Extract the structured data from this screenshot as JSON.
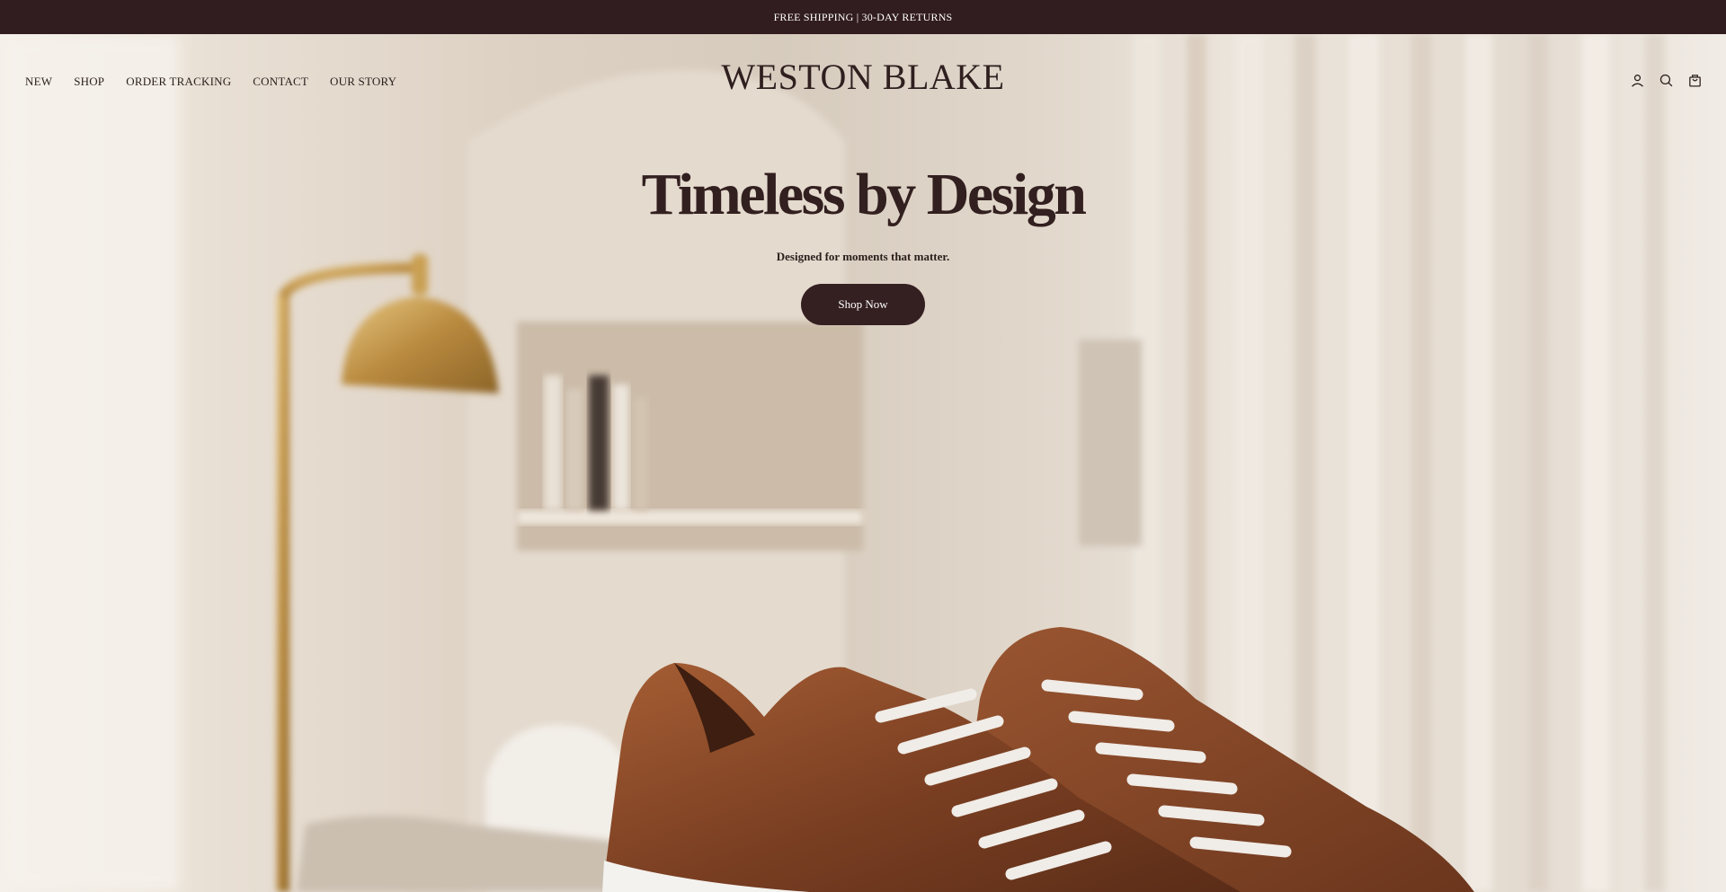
{
  "announcement": {
    "text": "FREE SHIPPING | 30-DAY RETURNS"
  },
  "header": {
    "logo": "WESTON BLAKE",
    "nav": [
      "NEW",
      "SHOP",
      "ORDER TRACKING",
      "CONTACT",
      "OUR STORY"
    ],
    "icons": [
      "account-icon",
      "search-icon",
      "cart-icon"
    ]
  },
  "hero": {
    "title": "Timeless by Design",
    "subtitle": "Designed for moments that matter.",
    "cta_label": "Shop Now",
    "image_description_icon": "sneaker-photo"
  },
  "colors": {
    "brand_dark": "#311c1f",
    "text": "#2b1e1c",
    "leather": "#8a4a2a",
    "brass": "#c9a25a"
  }
}
